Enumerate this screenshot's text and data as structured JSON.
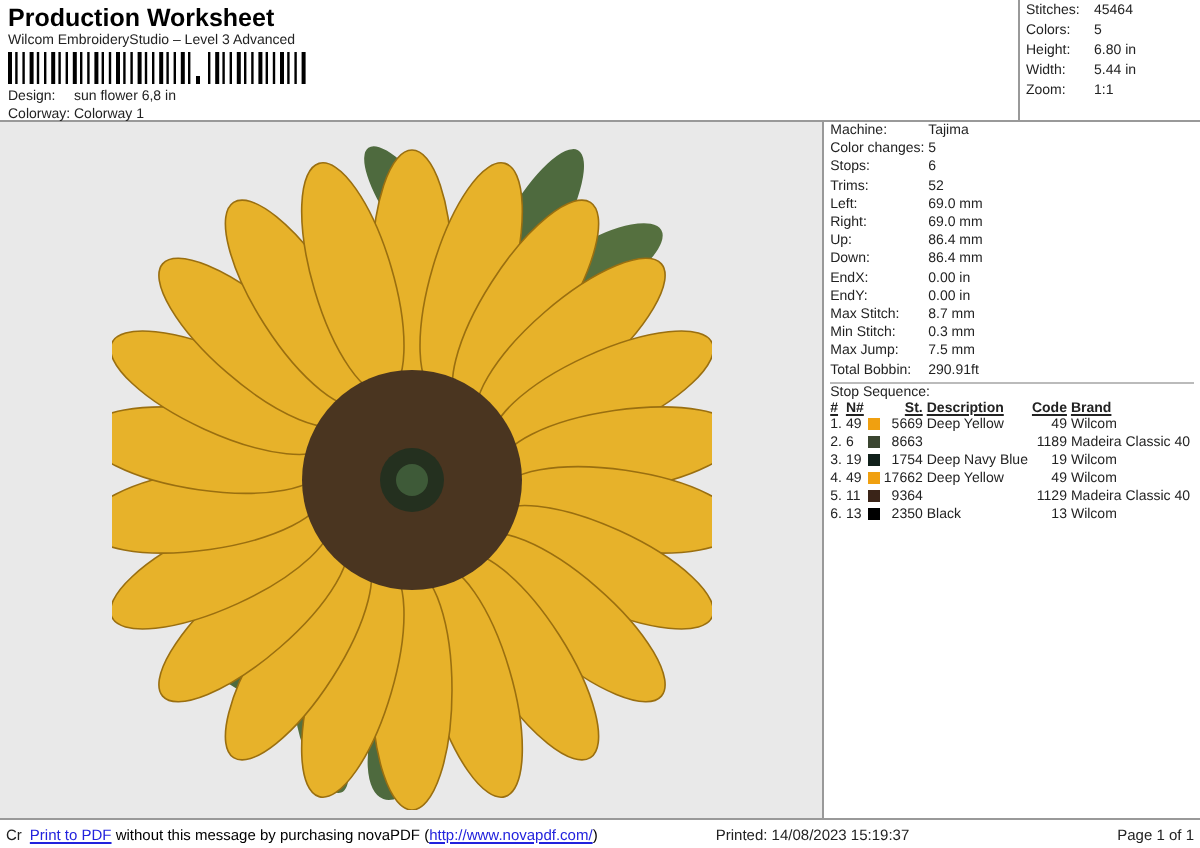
{
  "header": {
    "title": "Production Worksheet",
    "subtitle": "Wilcom EmbroideryStudio – Level 3 Advanced",
    "fields": [
      {
        "label": "Design:",
        "value": "sun flower 6,8 in"
      },
      {
        "label": "Colorway:",
        "value": "Colorway 1"
      }
    ]
  },
  "summary": [
    {
      "label": "Stitches:",
      "value": "45464"
    },
    {
      "label": "Colors:",
      "value": "5"
    },
    {
      "label": "Height:",
      "value": "6.80 in"
    },
    {
      "label": "Width:",
      "value": "5.44 in"
    },
    {
      "label": "Zoom:",
      "value": "1:1"
    }
  ],
  "details": [
    {
      "label": "Machine:",
      "value": "Tajima"
    },
    {
      "label": "Color changes:",
      "value": "5"
    },
    {
      "label": "Stops:",
      "value": "6"
    },
    {
      "label": "Trims:",
      "value": "52"
    },
    {
      "label": "Left:",
      "value": "69.0 mm"
    },
    {
      "label": "Right:",
      "value": "69.0 mm"
    },
    {
      "label": "Up:",
      "value": "86.4 mm"
    },
    {
      "label": "Down:",
      "value": "86.4 mm"
    },
    {
      "label": "EndX:",
      "value": "0.00 in"
    },
    {
      "label": "EndY:",
      "value": "0.00 in"
    },
    {
      "label": "Max Stitch:",
      "value": "8.7 mm"
    },
    {
      "label": "Min Stitch:",
      "value": "0.3 mm"
    },
    {
      "label": "Max Jump:",
      "value": "7.5 mm"
    },
    {
      "label": "Total Bobbin:",
      "value": "290.91ft"
    }
  ],
  "stop_sequence": {
    "title": "Stop Sequence:",
    "columns": [
      "#",
      "N#",
      "St.",
      "Description",
      "Code",
      "Brand"
    ],
    "rows": [
      {
        "index": "1.",
        "n": "49",
        "color": "#f0a010",
        "st": "5669",
        "description": "Deep Yellow",
        "code": "49",
        "brand": "Wilcom"
      },
      {
        "index": "2.",
        "n": "6",
        "color": "#3a4530",
        "st": "8663",
        "description": "",
        "code": "1189",
        "brand": "Madeira Classic 40"
      },
      {
        "index": "3.",
        "n": "19",
        "color": "#10201a",
        "st": "1754",
        "description": "Deep Navy Blue",
        "code": "19",
        "brand": "Wilcom"
      },
      {
        "index": "4.",
        "n": "49",
        "color": "#f0a010",
        "st": "17662",
        "description": "Deep Yellow",
        "code": "49",
        "brand": "Wilcom"
      },
      {
        "index": "5.",
        "n": "11",
        "color": "#3a2418",
        "st": "9364",
        "description": "",
        "code": "1129",
        "brand": "Madeira Classic 40"
      },
      {
        "index": "6.",
        "n": "13",
        "color": "#000000",
        "st": "2350",
        "description": "Black",
        "code": "13",
        "brand": "Wilcom"
      }
    ]
  },
  "footer": {
    "cut_text": "Cr",
    "link": "Print to PDF",
    "message": " without this message by purchasing novaPDF (",
    "url": "http://www.novapdf.com/",
    "close": ")",
    "printed": "Printed: 14/08/2023 15:19:37",
    "page": "Page 1 of 1"
  }
}
